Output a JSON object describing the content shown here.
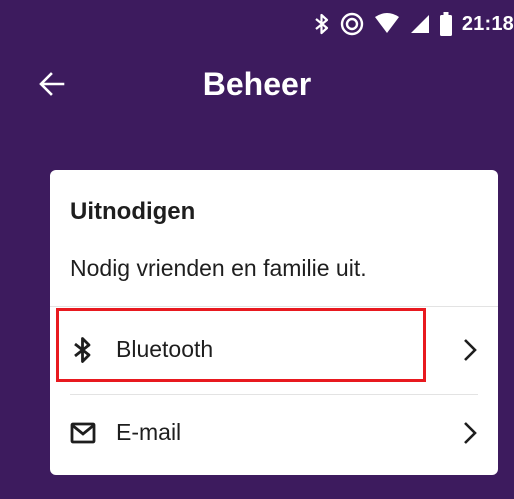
{
  "status_bar": {
    "time": "21:18",
    "icons": [
      "bluetooth-icon",
      "do-not-disturb-icon",
      "wifi-icon",
      "signal-icon",
      "battery-icon"
    ]
  },
  "toolbar": {
    "title": "Beheer",
    "back_icon": "arrow-left-icon"
  },
  "card": {
    "title": "Uitnodigen",
    "subtitle": "Nodig vrienden en familie uit.",
    "items": [
      {
        "label": "Bluetooth",
        "icon": "bluetooth-icon",
        "highlighted": true
      },
      {
        "label": "E-mail",
        "icon": "mail-icon",
        "highlighted": false
      }
    ]
  },
  "colors": {
    "background": "#3d1b5e",
    "card": "#ffffff",
    "highlight": "#e8191f",
    "text": "#1e1e1e"
  }
}
